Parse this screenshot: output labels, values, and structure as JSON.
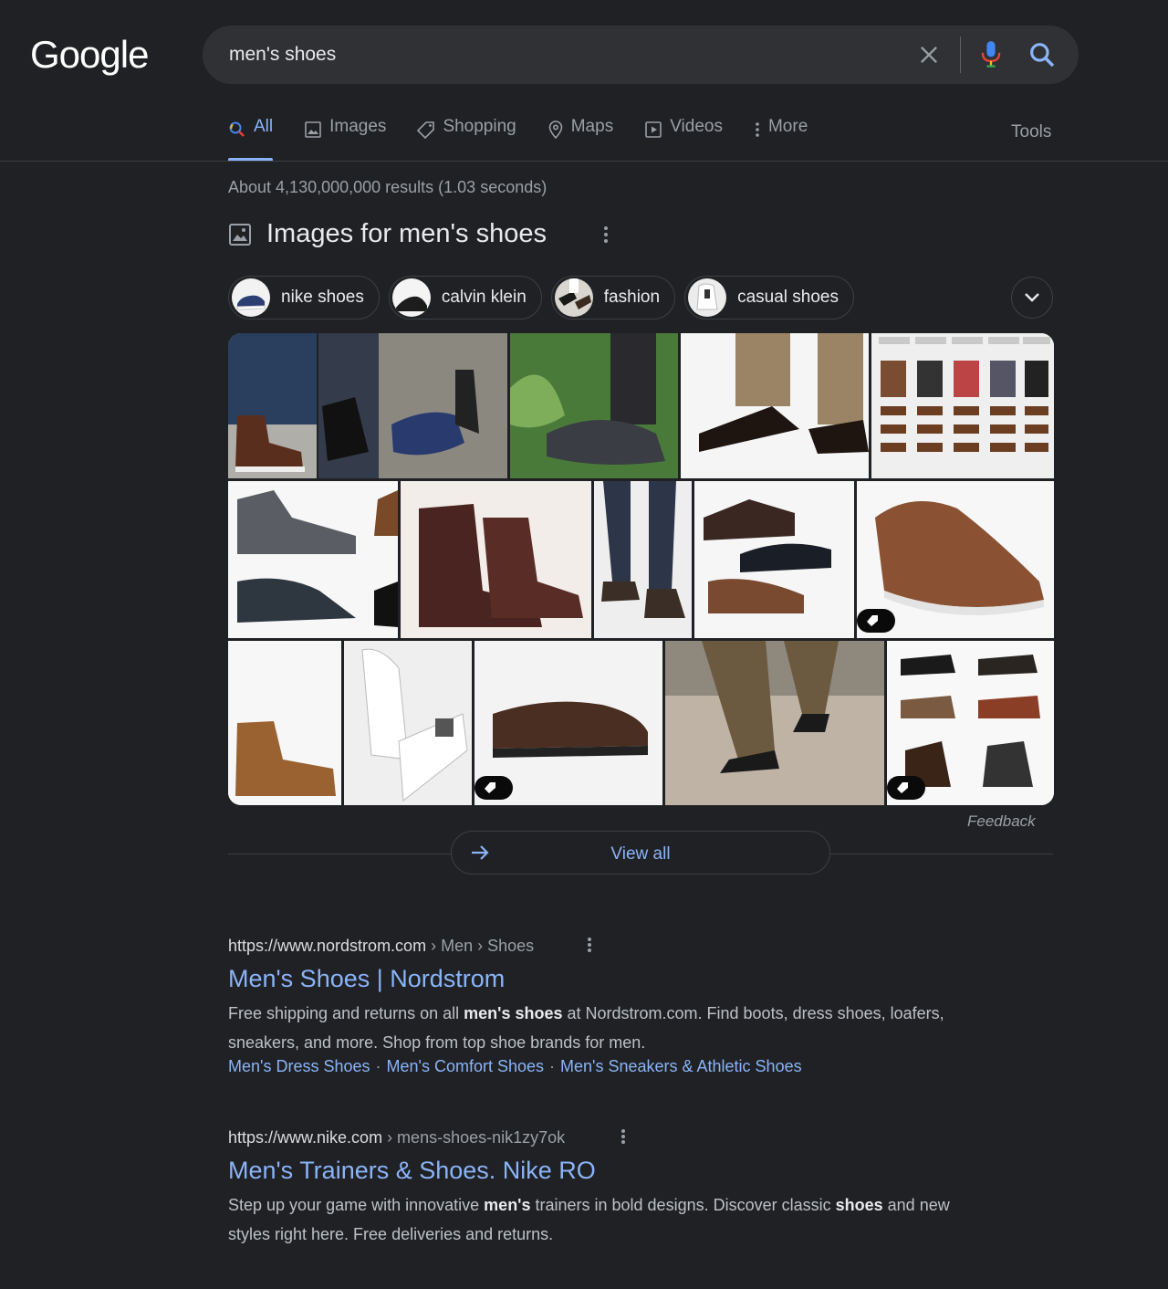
{
  "logo": "Google",
  "search": {
    "query": "men's shoes"
  },
  "icons": {
    "clear": "close-icon",
    "mic": "mic-icon",
    "search": "search-icon"
  },
  "tabs": [
    {
      "label": "All",
      "icon": "search-icon",
      "active": true
    },
    {
      "label": "Images",
      "icon": "image-icon"
    },
    {
      "label": "Shopping",
      "icon": "tag-icon"
    },
    {
      "label": "Maps",
      "icon": "pin-icon"
    },
    {
      "label": "Videos",
      "icon": "play-icon"
    },
    {
      "label": "More",
      "icon": "more-vert-icon"
    }
  ],
  "tools_label": "Tools",
  "stats": "About 4,130,000,000 results (1.03 seconds)",
  "images_section": {
    "title": "Images for men's shoes",
    "chips": [
      "nike shoes",
      "calvin klein",
      "fashion",
      "casual shoes"
    ],
    "feedback": "Feedback",
    "view_all": "View all"
  },
  "results": [
    {
      "url": "https://www.nordstrom.com",
      "path": " › Men › Shoes",
      "title": "Men's Shoes | Nordstrom",
      "snippet": [
        {
          "t": "Free shipping and returns on all "
        },
        {
          "t": "men's shoes",
          "b": true
        },
        {
          "t": " at Nordstrom.com. Find boots, dress shoes, loafers, sneakers, and more. Shop from top shoe brands for men."
        }
      ],
      "sitelinks": [
        "Men's Dress Shoes",
        "Men's Comfort Shoes",
        "Men's Sneakers & Athletic Shoes"
      ]
    },
    {
      "url": "https://www.nike.com",
      "path": " › mens-shoes-nik1zy7ok",
      "title": "Men's Trainers & Shoes. Nike RO",
      "snippet": [
        {
          "t": "Step up your game with innovative "
        },
        {
          "t": "men's",
          "b": true
        },
        {
          "t": " trainers in bold designs. Discover classic "
        },
        {
          "t": "shoes",
          "b": true
        },
        {
          "t": " and new styles right here. Free deliveries and returns."
        }
      ]
    }
  ],
  "colors": {
    "background": "#202124",
    "link": "#8ab4f8",
    "text": "#bdc1c6",
    "muted": "#9aa0a6"
  }
}
